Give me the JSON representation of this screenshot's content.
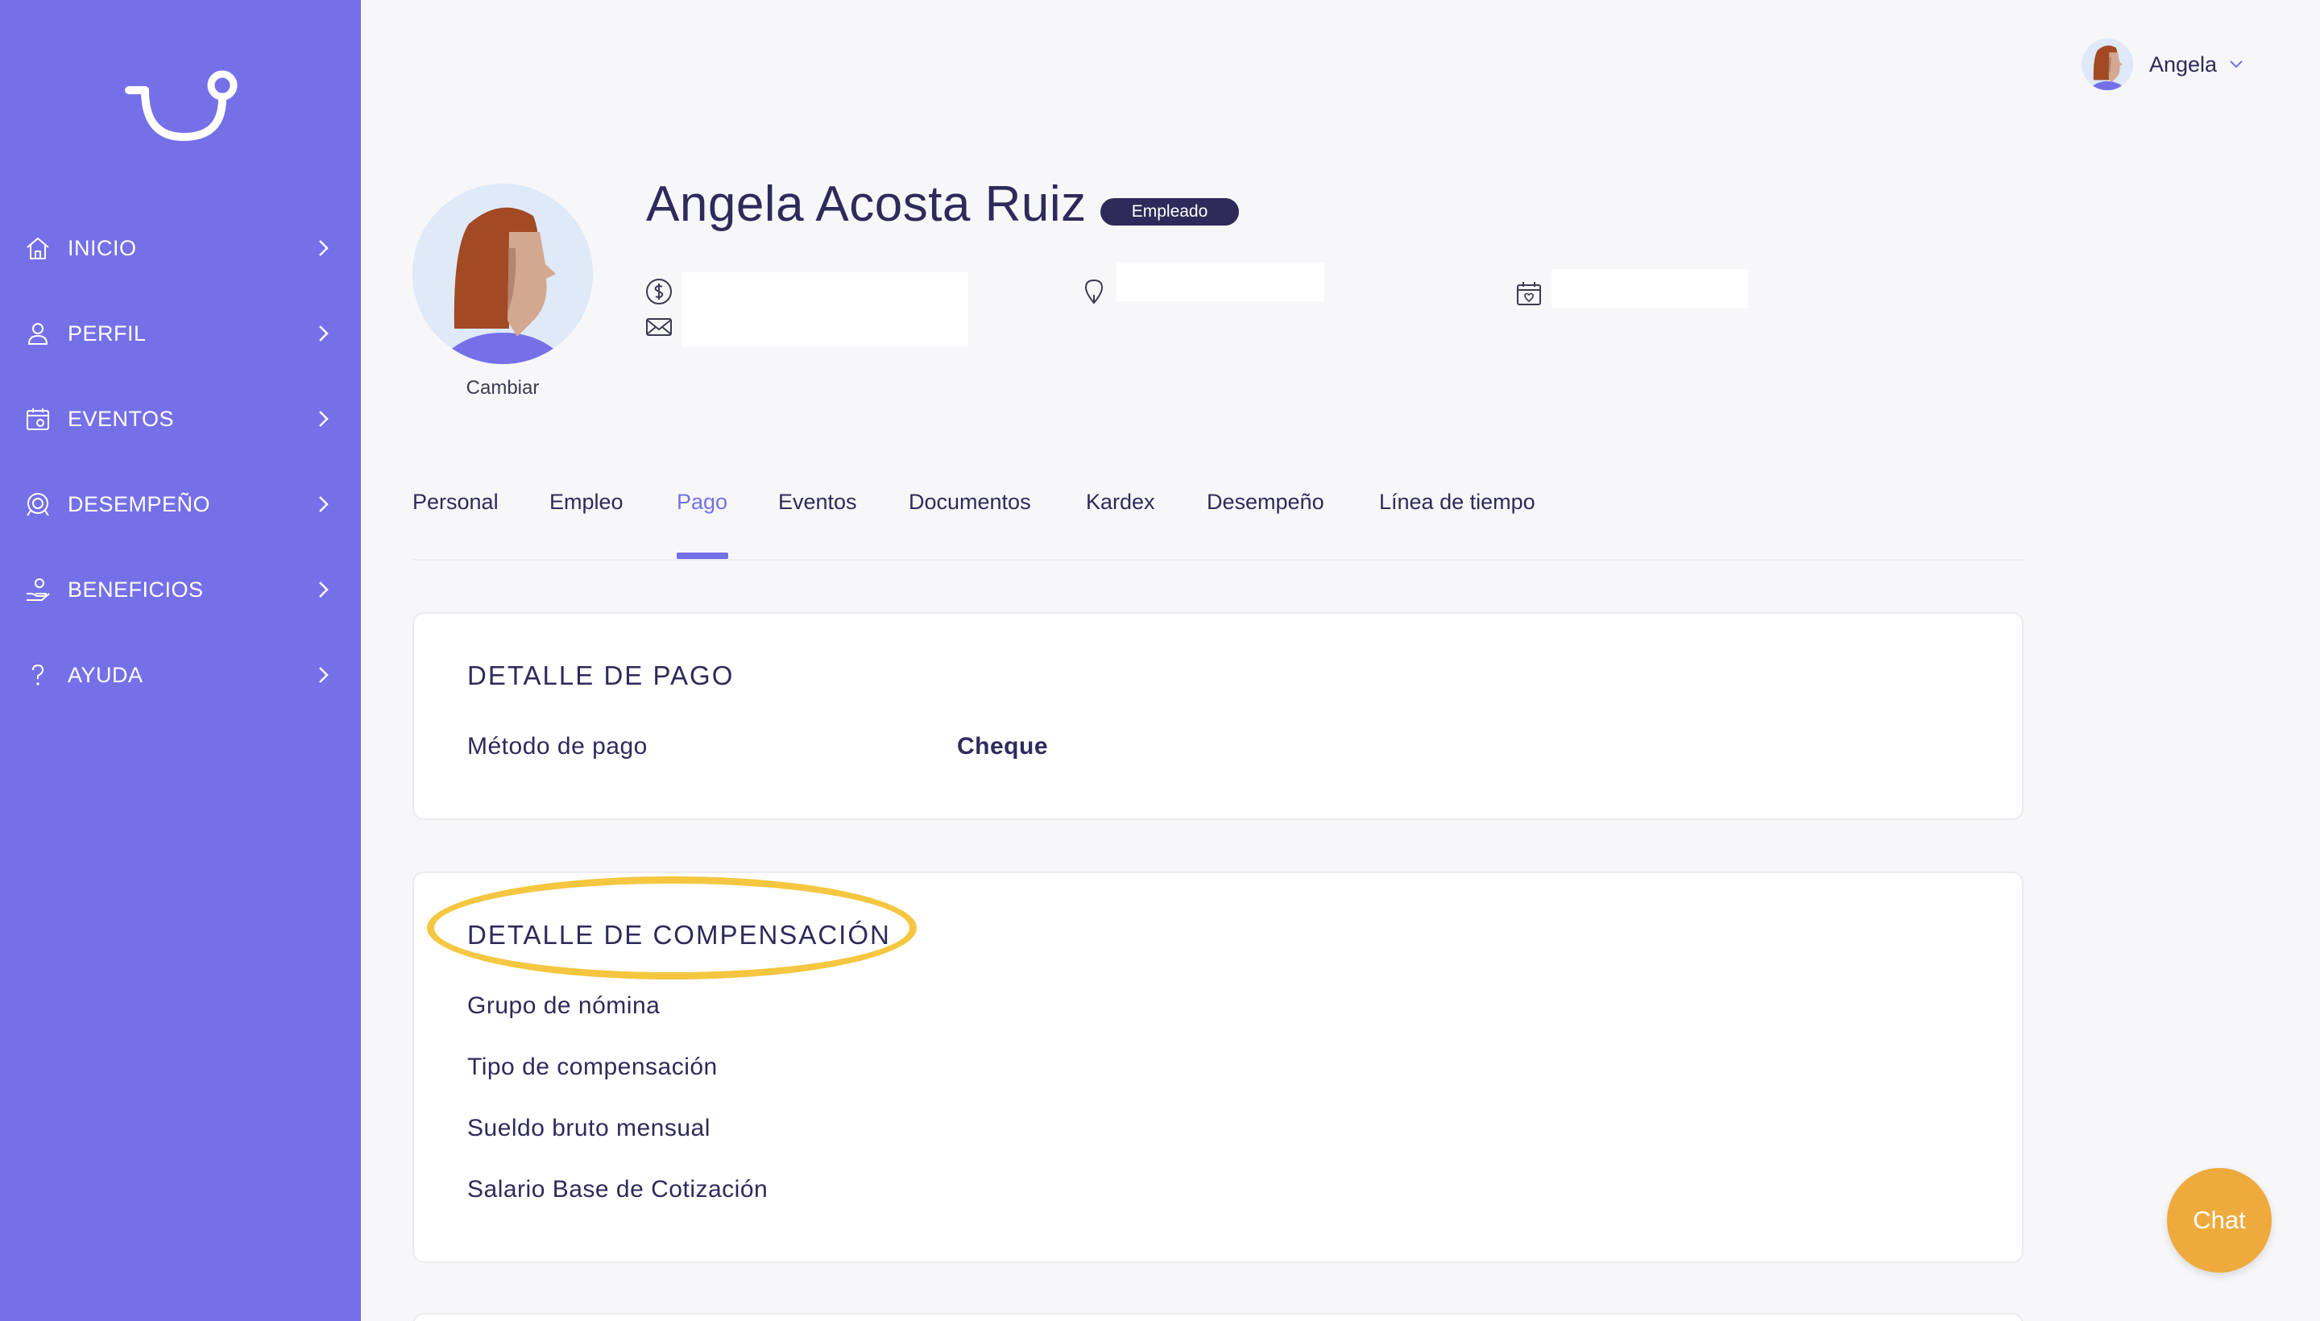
{
  "sidebar": {
    "items": [
      {
        "label": "INICIO",
        "icon": "home-icon"
      },
      {
        "label": "PERFIL",
        "icon": "user-icon"
      },
      {
        "label": "EVENTOS",
        "icon": "calendar-icon"
      },
      {
        "label": "DESEMPEÑO",
        "icon": "target-icon"
      },
      {
        "label": "BENEFICIOS",
        "icon": "benefits-icon"
      },
      {
        "label": "AYUDA",
        "icon": "help-icon"
      }
    ]
  },
  "user": {
    "name": "Angela"
  },
  "profile": {
    "full_name": "Angela Acosta Ruiz",
    "role": "Empleado",
    "change_label": "Cambiar"
  },
  "tabs": [
    {
      "label": "Personal",
      "active": false
    },
    {
      "label": "Empleo",
      "active": false
    },
    {
      "label": "Pago",
      "active": true
    },
    {
      "label": "Eventos",
      "active": false
    },
    {
      "label": "Documentos",
      "active": false
    },
    {
      "label": "Kardex",
      "active": false
    },
    {
      "label": "Desempeño",
      "active": false
    },
    {
      "label": "Línea de tiempo",
      "active": false
    }
  ],
  "payment_card": {
    "title": "DETALLE DE PAGO",
    "rows": [
      {
        "label": "Método de pago",
        "value": "Cheque"
      }
    ]
  },
  "compensation_card": {
    "title": "DETALLE DE COMPENSACIÓN",
    "rows": [
      {
        "label": "Grupo de nómina",
        "value": ""
      },
      {
        "label": "Tipo de compensación",
        "value": ""
      },
      {
        "label": "Sueldo bruto mensual",
        "value": ""
      },
      {
        "label": "Salario Base de Cotización",
        "value": ""
      }
    ]
  },
  "chat": {
    "label": "Chat"
  },
  "colors": {
    "sidebar": "#7570e8",
    "accent": "#7570e8",
    "text": "#2e2a5a",
    "highlight": "#f5c640",
    "chat": "#eeaa3c"
  }
}
